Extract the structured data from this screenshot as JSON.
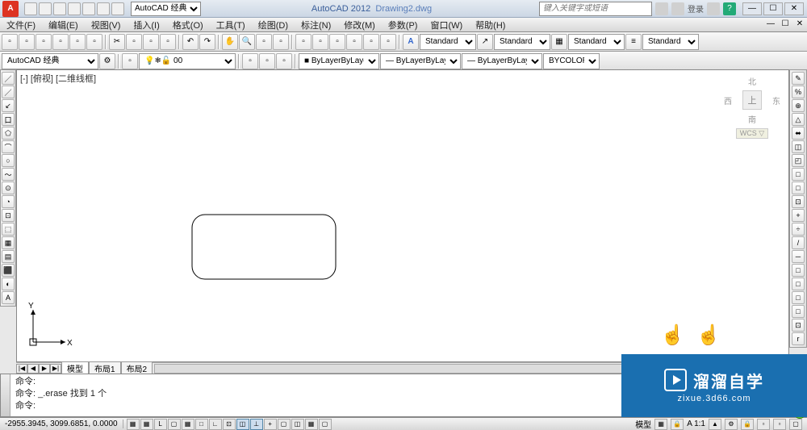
{
  "app": {
    "name": "AutoCAD 2012",
    "filename": "Drawing2.dwg"
  },
  "workspace_selector": "AutoCAD 经典",
  "search_placeholder": "键入关键字或短语",
  "login_label": "登录",
  "window_controls": {
    "min": "—",
    "max": "☐",
    "close": "✕"
  },
  "menus": [
    "文件(F)",
    "编辑(E)",
    "视图(V)",
    "插入(I)",
    "格式(O)",
    "工具(T)",
    "绘图(D)",
    "标注(N)",
    "修改(M)",
    "参数(P)",
    "窗口(W)",
    "帮助(H)"
  ],
  "std_dropdowns": {
    "textstyle": "Standard",
    "dimstyle": "Standard",
    "tablestyle": "Standard",
    "mlstyle": "Standard"
  },
  "layer_row": {
    "workspace": "AutoCAD 经典",
    "layer": "0",
    "color": "ByLayer",
    "linetype": "ByLayer",
    "lineweight": "ByLayer",
    "plotstyle": "BYCOLOR"
  },
  "viewport_label": "[-] [俯视] [二维线框]",
  "ucs": {
    "x": "X",
    "y": "Y"
  },
  "viewcube": {
    "n": "北",
    "s": "南",
    "e": "东",
    "w": "西",
    "top": "上",
    "wcs": "WCS ▽"
  },
  "tabs": {
    "model": "模型",
    "layout1": "布局1",
    "layout2": "布局2"
  },
  "cmd": {
    "line1": "命令:",
    "line2": "命令: _.erase 找到 1 个",
    "prompt": "命令:"
  },
  "status": {
    "coords": "-2955.3945, 3099.6851, 0.0000",
    "model_btn": "模型",
    "scale": "A 1:1",
    "annoscale": "▲"
  },
  "overlay": {
    "brand": "溜溜自学",
    "url": "zixue.3d66.com"
  },
  "left_tools": [
    "／",
    "／",
    "↙",
    "口",
    "⬠",
    "⌒",
    "○",
    "～",
    "⊙",
    "◔",
    "⊡",
    "⬚",
    "▦",
    "▤",
    "⬛",
    "◐",
    "A"
  ],
  "right_tools": [
    "✎",
    "%",
    "⊕",
    "△",
    "⬌",
    "◫",
    "◰",
    "□",
    "□",
    "⊡",
    "+",
    "÷",
    "/",
    "─",
    "□",
    "□",
    "□",
    "□",
    "⊡",
    "r"
  ],
  "status_btns": [
    "▦",
    "▦",
    "L",
    "▢",
    "▦",
    "□",
    "∟",
    "⊡",
    "◫",
    "⊥",
    "+",
    "▢",
    "◫",
    "▦",
    "▢"
  ]
}
